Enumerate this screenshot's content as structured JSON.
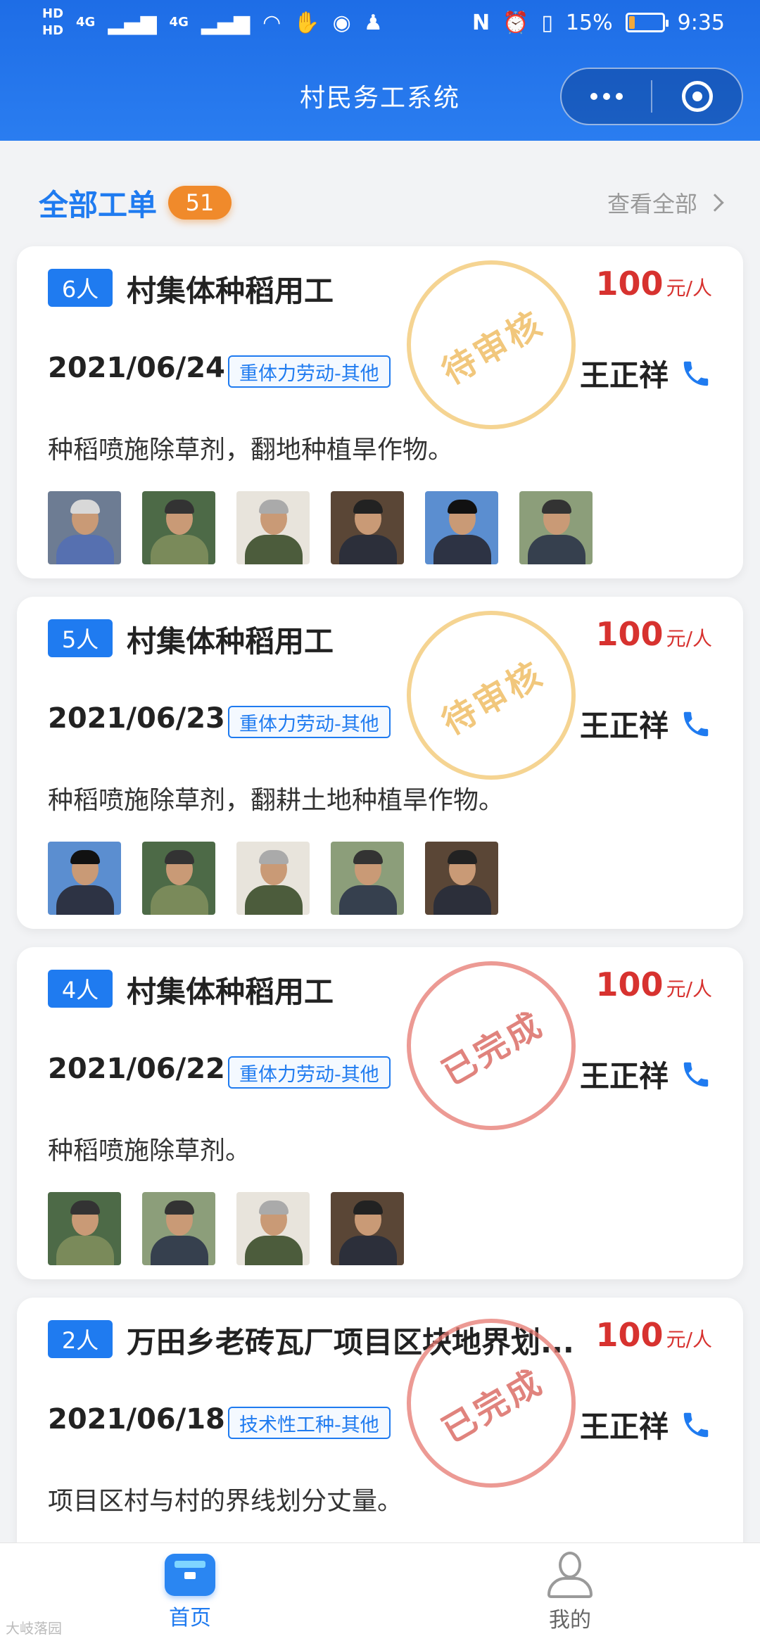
{
  "status_bar": {
    "hd1": "HD",
    "hd2": "HD",
    "net1": "4G",
    "net2": "4G",
    "nfc": "N",
    "battery_text": "15%",
    "battery_level": 0.15,
    "time": "9:35",
    "icons": [
      "signal-icon",
      "wifi-icon",
      "hand-icon",
      "app-icon",
      "qq-icon",
      "nfc-icon",
      "alarm-icon",
      "vibrate-icon",
      "battery-icon"
    ]
  },
  "header": {
    "title": "村民务工系统",
    "more_icon": "more-dots-icon",
    "close_icon": "target-icon"
  },
  "section": {
    "title": "全部工单",
    "count": "51",
    "view_all": "查看全部"
  },
  "orders": [
    {
      "people": "6人",
      "title": "村集体种稻用工",
      "price": "100",
      "price_unit": "元/人",
      "date": "2021/06/24",
      "category": "重体力劳动-其他",
      "contact": "王正祥",
      "description": "种稻喷施除草剂，翻地种植旱作物。",
      "status": "待审核",
      "status_type": "pending"
    },
    {
      "people": "5人",
      "title": "村集体种稻用工",
      "price": "100",
      "price_unit": "元/人",
      "date": "2021/06/23",
      "category": "重体力劳动-其他",
      "contact": "王正祥",
      "description": "种稻喷施除草剂，翻耕土地种植旱作物。",
      "status": "待审核",
      "status_type": "pending"
    },
    {
      "people": "4人",
      "title": "村集体种稻用工",
      "price": "100",
      "price_unit": "元/人",
      "date": "2021/06/22",
      "category": "重体力劳动-其他",
      "contact": "王正祥",
      "description": "种稻喷施除草剂。",
      "status": "已完成",
      "status_type": "done"
    },
    {
      "people": "2人",
      "title": "万田乡老砖瓦厂项目区块地界划...",
      "price": "100",
      "price_unit": "元/人",
      "date": "2021/06/18",
      "category": "技术性工种-其他",
      "contact": "王正祥",
      "description": "项目区村与村的界线划分丈量。",
      "status": "已完成",
      "status_type": "done"
    }
  ],
  "tabbar": {
    "home_label": "首页",
    "mine_label": "我的",
    "home_icon": "home-icon",
    "mine_icon": "user-icon"
  },
  "watermark": "大岐落园"
}
